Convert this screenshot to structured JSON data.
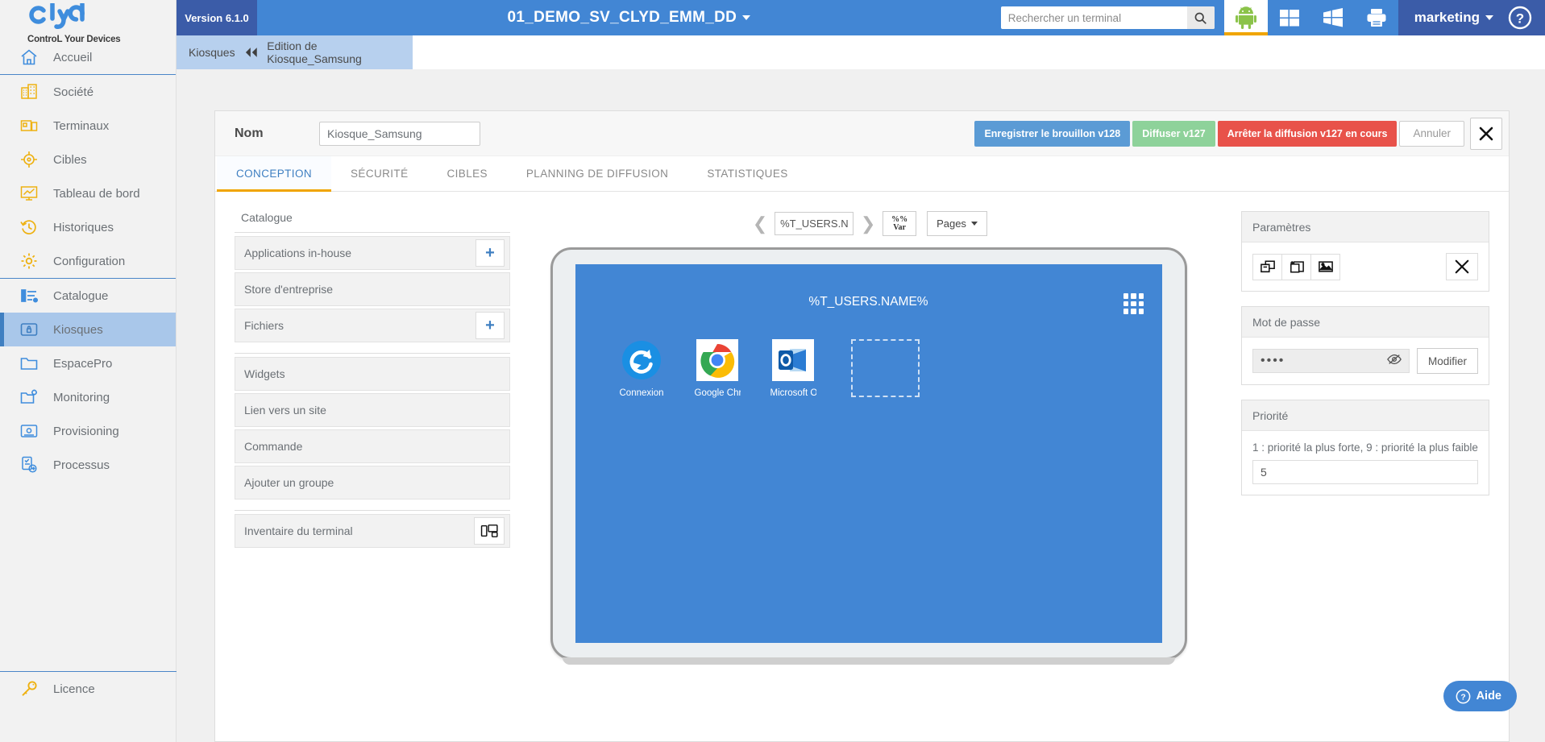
{
  "brand": {
    "name": "clyd",
    "tagline": "ControL Your Devices",
    "accent_blue": "#4286d4",
    "accent_dark_blue": "#3b5ca8",
    "accent_yellow": "#f0a500"
  },
  "topbar": {
    "version": "Version 6.1.0",
    "app_title": "01_DEMO_SV_CLYD_EMM_DD",
    "search_placeholder": "Rechercher un terminal",
    "search_value": "",
    "os_filters": [
      {
        "name": "android-icon",
        "selected": true
      },
      {
        "name": "windows10-icon",
        "selected": false
      },
      {
        "name": "windows-legacy-icon",
        "selected": false
      },
      {
        "name": "printer-icon",
        "selected": false
      }
    ],
    "user": "marketing",
    "help_icon": "question-circle-icon"
  },
  "breadcrumb": {
    "root": "Kiosques",
    "separator": "double-chevron-left-icon",
    "current": "Edition de Kiosque_Samsung"
  },
  "sidebar": {
    "groups": [
      {
        "items": [
          {
            "label": "Accueil",
            "icon": "home-icon",
            "color": "blue",
            "active": false
          }
        ]
      },
      {
        "items": [
          {
            "label": "Société",
            "icon": "building-icon",
            "color": "yellow",
            "active": false
          },
          {
            "label": "Terminaux",
            "icon": "devices-icon",
            "color": "yellow",
            "active": false
          },
          {
            "label": "Cibles",
            "icon": "target-icon",
            "color": "yellow",
            "active": false
          },
          {
            "label": "Tableau de bord",
            "icon": "monitor-chart-icon",
            "color": "yellow",
            "active": false
          },
          {
            "label": "Historiques",
            "icon": "clock-history-icon",
            "color": "yellow",
            "active": false
          },
          {
            "label": "Configuration",
            "icon": "gear-icon",
            "color": "yellow",
            "active": false
          }
        ]
      },
      {
        "items": [
          {
            "label": "Catalogue",
            "icon": "list-settings-icon",
            "color": "blue",
            "active": false
          },
          {
            "label": "Kiosques",
            "icon": "lock-screen-icon",
            "color": "blue",
            "active": true
          },
          {
            "label": "EspacePro",
            "icon": "folder-icon",
            "color": "blue",
            "active": false
          },
          {
            "label": "Monitoring",
            "icon": "folder-gear-icon",
            "color": "blue",
            "active": false
          },
          {
            "label": "Provisioning",
            "icon": "device-gear-icon",
            "color": "blue",
            "active": false
          },
          {
            "label": "Processus",
            "icon": "process-arrow-icon",
            "color": "blue",
            "active": false
          }
        ]
      }
    ],
    "footer": {
      "label": "Licence",
      "icon": "key-icon",
      "color": "yellow"
    },
    "collapse_handle": "sidebar-collapse-handle"
  },
  "editor": {
    "nom_label": "Nom",
    "nom_value": "Kiosque_Samsung",
    "actions": {
      "save_draft": "Enregistrer le brouillon v128",
      "publish": "Diffuser v127",
      "stop_publish": "Arrêter la diffusion v127 en cours",
      "cancel": "Annuler",
      "close_icon": "close-icon"
    },
    "tabs": [
      {
        "label": "CONCEPTION",
        "active": true
      },
      {
        "label": "SÉCURITÉ",
        "active": false
      },
      {
        "label": "CIBLES",
        "active": false
      },
      {
        "label": "PLANNING DE DIFFUSION",
        "active": false
      },
      {
        "label": "STATISTIQUES",
        "active": false
      }
    ]
  },
  "catalogue": {
    "title": "Catalogue",
    "blocks": [
      {
        "rows": [
          {
            "label": "Applications in-house",
            "action": "add-icon"
          },
          {
            "label": "Store d'entreprise",
            "action": null
          },
          {
            "label": "Fichiers",
            "action": "add-icon"
          }
        ]
      },
      {
        "rows": [
          {
            "label": "Widgets",
            "action": null
          },
          {
            "label": "Lien vers un site",
            "action": null
          },
          {
            "label": "Commande",
            "action": null
          },
          {
            "label": "Ajouter un groupe",
            "action": null
          }
        ]
      },
      {
        "rows": [
          {
            "label": "Inventaire du terminal",
            "action": "inventory-icon"
          }
        ]
      }
    ]
  },
  "preview": {
    "nav": {
      "prev_icon": "chevron-left-icon",
      "next_icon": "chevron-right-icon",
      "page_name": "%T_USERS.NAI",
      "var_button_top": "%%",
      "var_button_bottom": "Var",
      "pages_button": "Pages"
    },
    "screen": {
      "title": "%T_USERS.NAME%",
      "grid_icon": "app-grid-icon",
      "background": "#4286d4",
      "apps": [
        {
          "label": "Connexion",
          "icon": "connexion-sync-icon"
        },
        {
          "label": "Google Chro...",
          "icon": "google-chrome-icon"
        },
        {
          "label": "Microsoft Ou...",
          "icon": "microsoft-outlook-icon"
        }
      ],
      "placeholder_slot": true
    }
  },
  "right_panels": {
    "parametres": {
      "title": "Paramètres",
      "buttons": [
        {
          "name": "screen-layers-icon"
        },
        {
          "name": "add-page-icon"
        },
        {
          "name": "image-icon"
        },
        {
          "name": "tools-icon"
        }
      ]
    },
    "mot_de_passe": {
      "title": "Mot de passe",
      "value": "••••",
      "eye_icon": "eye-slash-icon",
      "modify_label": "Modifier"
    },
    "priorite": {
      "title": "Priorité",
      "hint": "1 : priorité la plus forte, 9 : priorité la plus faible",
      "value": "5"
    }
  },
  "help_fab": {
    "label": "Aide",
    "icon": "question-circle-icon"
  }
}
